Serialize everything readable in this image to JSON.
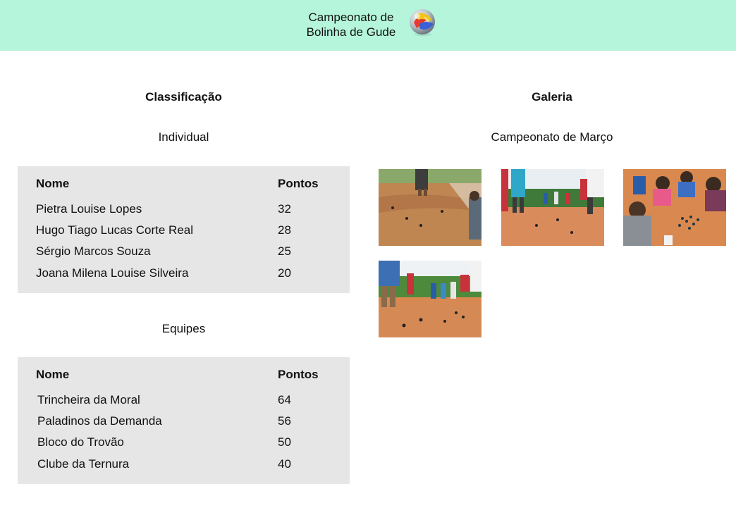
{
  "header": {
    "title_line1": "Campeonato de",
    "title_line2": "Bolinha de Gude",
    "logo_icon": "marble-icon"
  },
  "ranking": {
    "title": "Classificação",
    "individual": {
      "subtitle": "Individual",
      "headers": {
        "name": "Nome",
        "points": "Pontos"
      },
      "rows": [
        {
          "name": "Pietra Louise Lopes",
          "points": "32"
        },
        {
          "name": "Hugo Tiago Lucas Corte Real",
          "points": "28"
        },
        {
          "name": "Sérgio Marcos Souza",
          "points": "25"
        },
        {
          "name": "Joana Milena Louise Silveira",
          "points": "20"
        }
      ]
    },
    "teams": {
      "subtitle": "Equipes",
      "headers": {
        "name": "Nome",
        "points": "Pontos"
      },
      "rows": [
        {
          "name": "Trincheira da Moral",
          "points": "64"
        },
        {
          "name": "Paladinos da Demanda",
          "points": "56"
        },
        {
          "name": "Bloco do Trovão",
          "points": "50"
        },
        {
          "name": "Clube da Ternura",
          "points": "40"
        }
      ]
    }
  },
  "gallery": {
    "title": "Galeria",
    "subtitle": "Campeonato de Março",
    "photos": [
      {
        "name": "photo-1"
      },
      {
        "name": "photo-2"
      },
      {
        "name": "photo-3"
      },
      {
        "name": "photo-4"
      }
    ]
  },
  "colors": {
    "header_bg": "#b5f5dc",
    "table_bg": "#e6e6e6"
  }
}
